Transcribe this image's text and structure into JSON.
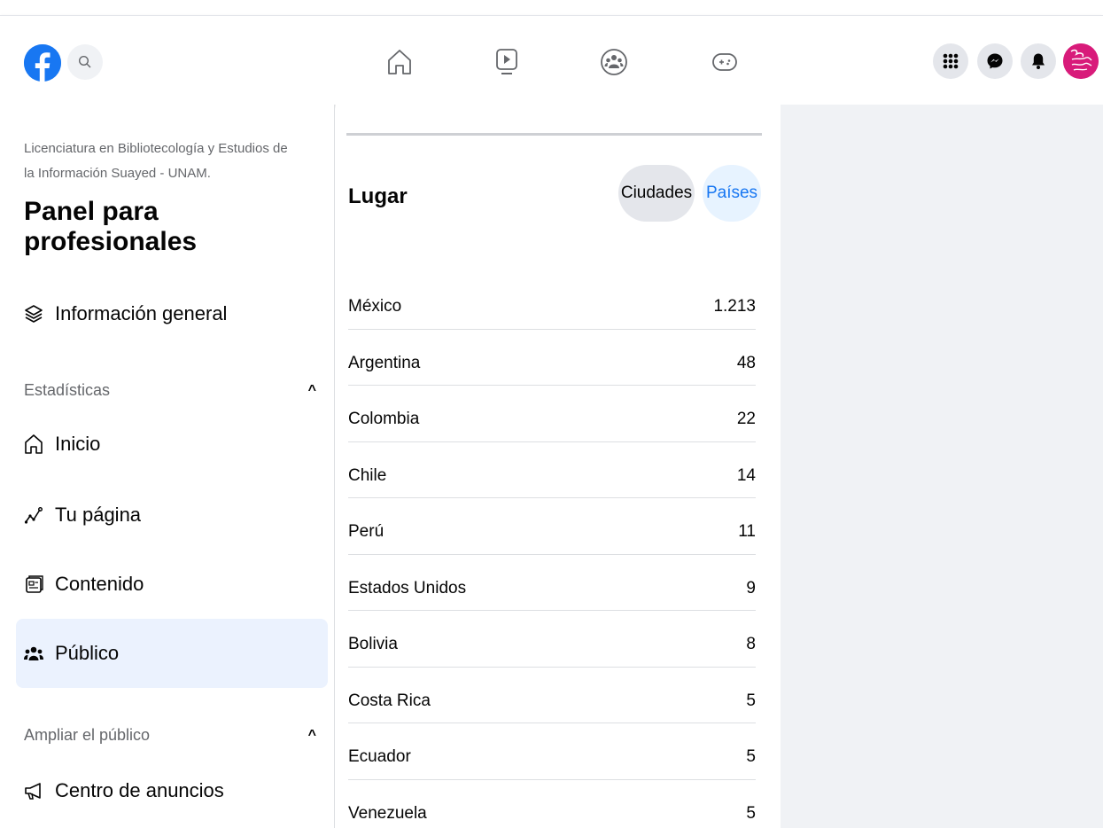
{
  "topbar": {
    "icons": {
      "logo": "facebook-logo",
      "search": "search-icon",
      "home": "home-icon",
      "watch": "video-icon",
      "groups": "groups-icon",
      "gaming": "gaming-icon",
      "menu": "grid-menu-icon",
      "messenger": "messenger-icon",
      "notifications": "bell-icon"
    },
    "accent": "#1877f2"
  },
  "sidebar": {
    "page_name": "Licenciatura en Bibliotecología y Estudios de la Información Suayed - UNAM.",
    "title": "Panel para profesionales",
    "overview": "Información general",
    "stats_header": "Estadísticas",
    "items": [
      {
        "label": "Inicio",
        "icon": "home-icon"
      },
      {
        "label": "Tu página",
        "icon": "trend-icon"
      },
      {
        "label": "Contenido",
        "icon": "content-icon"
      },
      {
        "label": "Público",
        "icon": "audience-icon"
      }
    ],
    "expand_header": "Ampliar el público",
    "ads_center": "Centro de anuncios"
  },
  "main": {
    "title": "Lugar",
    "tabs": {
      "cities": "Ciudades",
      "countries": "Países"
    },
    "rows": [
      {
        "country": "México",
        "count": "1.213"
      },
      {
        "country": "Argentina",
        "count": "48"
      },
      {
        "country": "Colombia",
        "count": "22"
      },
      {
        "country": "Chile",
        "count": "14"
      },
      {
        "country": "Perú",
        "count": "11"
      },
      {
        "country": "Estados Unidos",
        "count": "9"
      },
      {
        "country": "Bolivia",
        "count": "8"
      },
      {
        "country": "Costa Rica",
        "count": "5"
      },
      {
        "country": "Ecuador",
        "count": "5"
      },
      {
        "country": "Venezuela",
        "count": "5"
      }
    ]
  }
}
